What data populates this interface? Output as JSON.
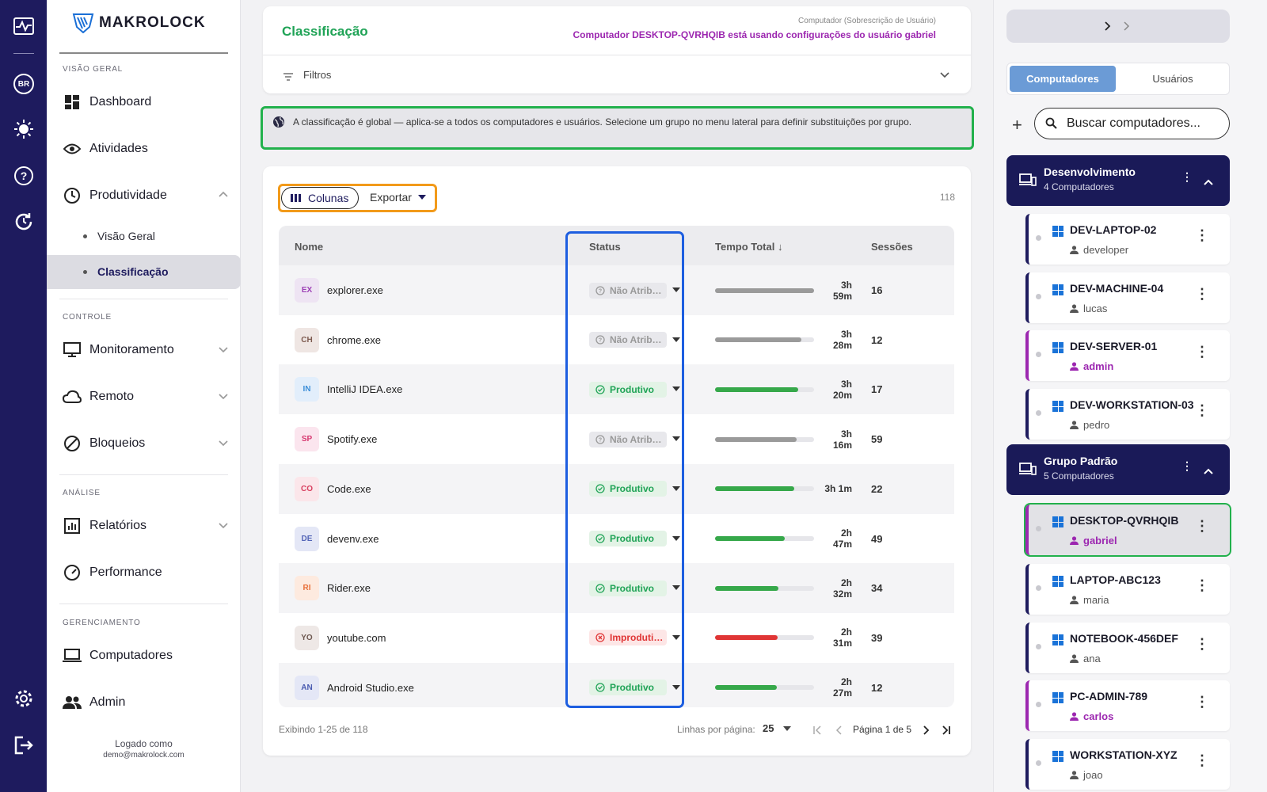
{
  "rail": {
    "lang": "BR"
  },
  "brand": {
    "name": "MAKROLOCK"
  },
  "sidebar": {
    "sections": [
      "VISÃO GERAL",
      "CONTROLE",
      "ANÁLISE",
      "GERENCIAMENTO"
    ],
    "items": {
      "dashboard": "Dashboard",
      "atividades": "Atividades",
      "produtividade": "Produtividade",
      "visao_geral": "Visão Geral",
      "classificacao": "Classificação",
      "monitoramento": "Monitoramento",
      "remoto": "Remoto",
      "bloqueios": "Bloqueios",
      "relatorios": "Relatórios",
      "performance": "Performance",
      "computadores": "Computadores",
      "admin": "Admin"
    },
    "login_label": "Logado como",
    "login_email": "demo@makrolock.com"
  },
  "header": {
    "title": "Classificação",
    "context_label": "Computador (Sobrescrição de Usuário)",
    "context_message": "Computador DESKTOP-QVRHQIB está usando configurações do usuário gabriel",
    "filters_label": "Filtros"
  },
  "info": {
    "text": "A classificação é global — aplica-se a todos os computadores e usuários. Selecione um grupo no menu lateral para definir substituições por grupo."
  },
  "toolbar": {
    "columns_label": "Colunas",
    "export_label": "Exportar",
    "count": "118"
  },
  "table": {
    "headers": {
      "name": "Nome",
      "status": "Status",
      "time": "Tempo Total",
      "sessions": "Sessões"
    },
    "rows": [
      {
        "abbr": "EX",
        "name": "explorer.exe",
        "status": "Não Atrib…",
        "kind": "na",
        "time": "3h 59m",
        "fill": 1.0,
        "sessions": "16"
      },
      {
        "abbr": "CH",
        "name": "chrome.exe",
        "status": "Não Atrib…",
        "kind": "na",
        "time": "3h 28m",
        "fill": 0.87,
        "sessions": "12"
      },
      {
        "abbr": "IN",
        "name": "IntelliJ IDEA.exe",
        "status": "Produtivo",
        "kind": "prod",
        "time": "3h 20m",
        "fill": 0.84,
        "sessions": "17"
      },
      {
        "abbr": "SP",
        "name": "Spotify.exe",
        "status": "Não Atrib…",
        "kind": "na",
        "time": "3h 16m",
        "fill": 0.82,
        "sessions": "59"
      },
      {
        "abbr": "CO",
        "name": "Code.exe",
        "status": "Produtivo",
        "kind": "prod",
        "time": "3h 1m",
        "fill": 0.8,
        "sessions": "22"
      },
      {
        "abbr": "DE",
        "name": "devenv.exe",
        "status": "Produtivo",
        "kind": "prod",
        "time": "2h 47m",
        "fill": 0.7,
        "sessions": "49"
      },
      {
        "abbr": "RI",
        "name": "Rider.exe",
        "status": "Produtivo",
        "kind": "prod",
        "time": "2h 32m",
        "fill": 0.64,
        "sessions": "34"
      },
      {
        "abbr": "YO",
        "name": "youtube.com",
        "status": "Improduti…",
        "kind": "unprod",
        "time": "2h 31m",
        "fill": 0.63,
        "sessions": "39"
      },
      {
        "abbr": "AN",
        "name": "Android Studio.exe",
        "status": "Produtivo",
        "kind": "prod",
        "time": "2h 27m",
        "fill": 0.62,
        "sessions": "12"
      }
    ]
  },
  "pagination": {
    "showing": "Exibindo 1-25 de 118",
    "rows_label": "Linhas por página:",
    "rows_value": "25",
    "page_label": "Página 1 de 5"
  },
  "right": {
    "tab_computers": "Computadores",
    "tab_users": "Usuários",
    "search_placeholder": "Buscar computadores...",
    "groups": [
      {
        "name": "Desenvolvimento",
        "count": "4 Computadores"
      },
      {
        "name": "Grupo Padrão",
        "count": "5 Computadores"
      }
    ],
    "computers": [
      {
        "name": "DEV-LAPTOP-02",
        "user": "developer",
        "override": false
      },
      {
        "name": "DEV-MACHINE-04",
        "user": "lucas",
        "override": false
      },
      {
        "name": "DEV-SERVER-01",
        "user": "admin",
        "override": true
      },
      {
        "name": "DEV-WORKSTATION-03",
        "user": "pedro",
        "override": false
      },
      {
        "name": "DESKTOP-QVRHQIB",
        "user": "gabriel",
        "override": true,
        "selected": true
      },
      {
        "name": "LAPTOP-ABC123",
        "user": "maria",
        "override": false
      },
      {
        "name": "NOTEBOOK-456DEF",
        "user": "ana",
        "override": false
      },
      {
        "name": "PC-ADMIN-789",
        "user": "carlos",
        "override": true
      },
      {
        "name": "WORKSTATION-XYZ",
        "user": "joao",
        "override": false
      }
    ]
  },
  "colors": {
    "accent": "#1e1b5e",
    "green": "#1fa356",
    "purple": "#9c27b0",
    "blue_tab": "#6b9bd6",
    "highlight_green": "#22b14c",
    "highlight_orange": "#f29a1a",
    "highlight_blue": "#1d5ee0"
  }
}
